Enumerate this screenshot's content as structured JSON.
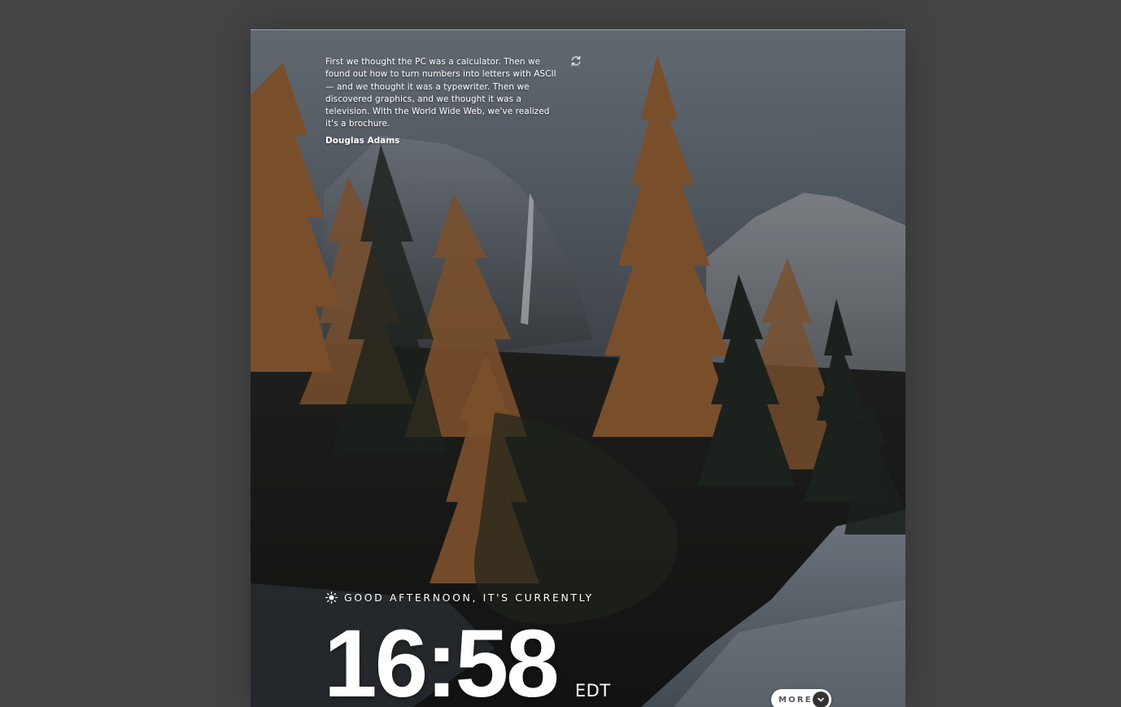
{
  "quote": {
    "text": "First we thought the PC was a calculator. Then we found out how to turn numbers into letters with ASCII — and we thought it was a typewriter. Then we discovered graphics, and we thought it was a television. With the World Wide Web, we've realized it's a brochure.",
    "author": "Douglas Adams",
    "refresh_icon": "refresh-icon"
  },
  "greeting": {
    "icon": "sun-icon",
    "text": "Good afternoon, it's currently"
  },
  "clock": {
    "time": "16:58",
    "timezone": "EDT"
  },
  "more": {
    "label": "MORE",
    "icon": "chevron-down-icon"
  },
  "colors": {
    "background": "#444444",
    "text": "#ffffff",
    "button_bg": "#ffffff",
    "button_icon_bg": "#333333"
  }
}
